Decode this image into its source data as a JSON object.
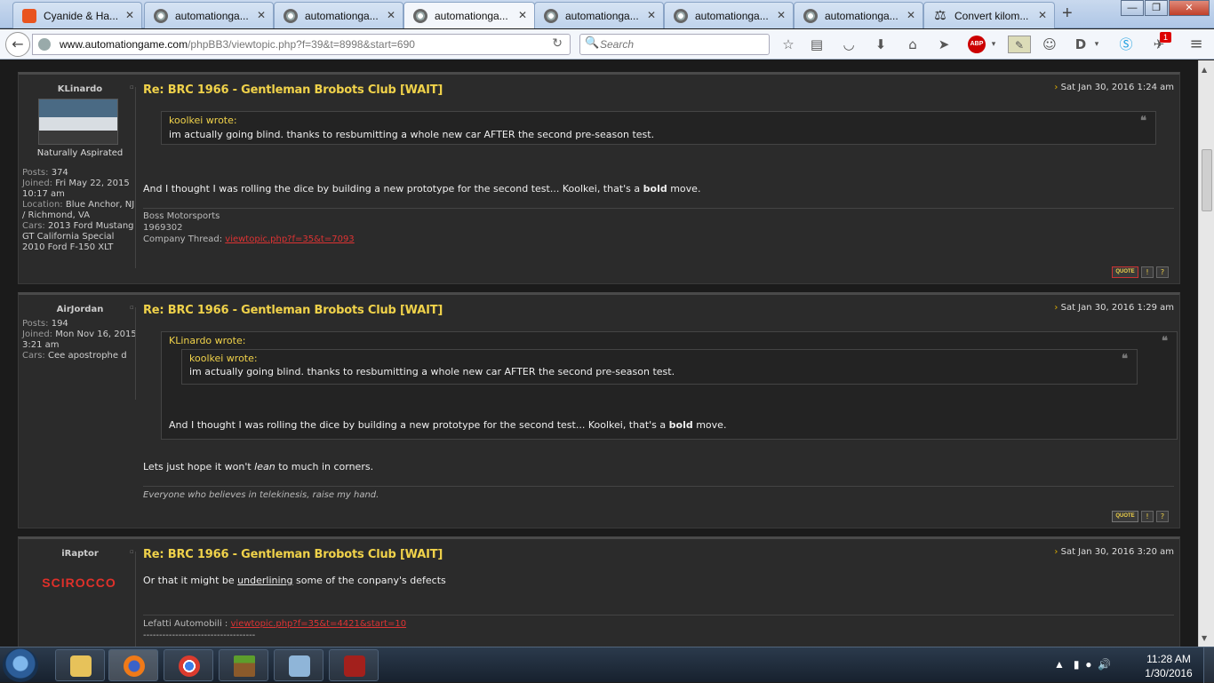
{
  "browser": {
    "tabs": [
      {
        "label": "Cyanide & Ha...",
        "icon": "cyanide-favicon",
        "active": false
      },
      {
        "label": "automationga...",
        "icon": "automation-gear-favicon",
        "active": false
      },
      {
        "label": "automationga...",
        "icon": "automation-gear-favicon",
        "active": false
      },
      {
        "label": "automationga...",
        "icon": "automation-gear-favicon",
        "active": true
      },
      {
        "label": "automationga...",
        "icon": "automation-gear-favicon",
        "active": false
      },
      {
        "label": "automationga...",
        "icon": "automation-gear-favicon",
        "active": false
      },
      {
        "label": "automationga...",
        "icon": "automation-gear-favicon",
        "active": false
      },
      {
        "label": "Convert kilom...",
        "icon": "scales-favicon",
        "active": false
      }
    ],
    "tab_close": "✕",
    "new_tab": "+",
    "url_domain": "www.automationgame.com",
    "url_path": "/phpBB3/viewtopic.php?f=39&t=8998&start=690",
    "search_placeholder": "Search",
    "badge_count": "1"
  },
  "posts": [
    {
      "author": "KLinardo",
      "rank": "Naturally Aspirated",
      "profile": [
        {
          "k": "Posts:",
          "v": "374"
        },
        {
          "k": "Joined:",
          "v": "Fri May 22, 2015 10:17 am"
        },
        {
          "k": "Location:",
          "v": "Blue Anchor, NJ / Richmond, VA"
        },
        {
          "k": "Cars:",
          "v": "2013 Ford Mustang GT California Special 2010 Ford F-150 XLT"
        }
      ],
      "title": "Re: BRC 1966 - Gentleman Brobots Club [WAIT]",
      "date": "Sat Jan 30, 2016 1:24 am",
      "quote_author": "koolkei wrote:",
      "quote_text": "im actually going blind. thanks to resbumitting a whole new car AFTER the second pre-season test.",
      "body_pre": "And I thought I was rolling the dice by building a new prototype for the second test... Koolkei, that's a ",
      "body_bold": "bold",
      "body_post": " move.",
      "sig_line1": "Boss Motorsports",
      "sig_line2": "1969302",
      "sig_label": "Company Thread:",
      "sig_link": "viewtopic.php?f=35&t=7093"
    },
    {
      "author": "AirJordan",
      "profile": [
        {
          "k": "Posts:",
          "v": "194"
        },
        {
          "k": "Joined:",
          "v": "Mon Nov 16, 2015 3:21 am"
        },
        {
          "k": "Cars:",
          "v": "Cee apostrophe d"
        }
      ],
      "title": "Re: BRC 1966 - Gentleman Brobots Club [WAIT]",
      "date": "Sat Jan 30, 2016 1:29 am",
      "outer_quote_author": "KLinardo wrote:",
      "inner_quote_author": "koolkei wrote:",
      "inner_quote_text": "im actually going blind. thanks to resbumitting a whole new car AFTER the second pre-season test.",
      "outer_quote_pre": "And I thought I was rolling the dice by building a new prototype for the second test... Koolkei, that's a ",
      "outer_quote_bold": "bold",
      "outer_quote_post": " move.",
      "body_pre": "Lets just hope it won't ",
      "body_italic": "lean",
      "body_post": " to much in corners.",
      "sig": "Everyone who believes in telekinesis, raise my hand."
    },
    {
      "author": "iRaptor",
      "avatar_text": "SCIROCCO",
      "title": "Re: BRC 1966 - Gentleman Brobots Club [WAIT]",
      "date": "Sat Jan 30, 2016 3:20 am",
      "body_pre": "Or that it might be ",
      "body_underline": "underlining",
      "body_post": " some of the conpany's defects",
      "sig_label": "Lefatti Automobili :",
      "sig_link": "viewtopic.php?f=35&t=4421&start=10",
      "sig_rule": "-----------------------------------"
    }
  ],
  "post_buttons": {
    "quote": "QUOTE",
    "warn": "!",
    "report": "?"
  },
  "taskbar": {
    "time": "11:28 AM",
    "date": "1/30/2016"
  },
  "colors": {
    "title_yellow": "#f0d24a",
    "post_bg": "#2b2b2b",
    "page_bg": "#1b1b1b",
    "link_red": "#dd3333"
  }
}
